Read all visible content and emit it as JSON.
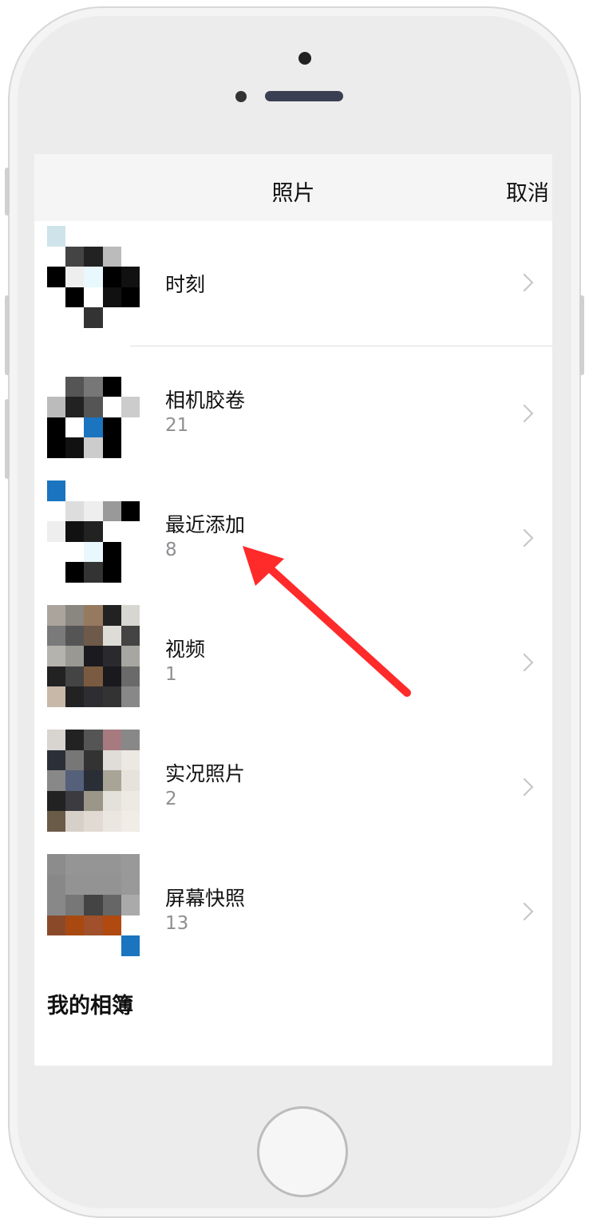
{
  "navbar": {
    "title": "照片",
    "cancel": "取消"
  },
  "albums": [
    {
      "title": "时刻",
      "count": ""
    },
    {
      "title": "相机胶卷",
      "count": "21"
    },
    {
      "title": "最近添加",
      "count": "8"
    },
    {
      "title": "视频",
      "count": "1"
    },
    {
      "title": "实况照片",
      "count": "2"
    },
    {
      "title": "屏幕快照",
      "count": "13"
    }
  ],
  "section": {
    "my_albums": "我的相簿"
  },
  "icons": {
    "chevron": "chevron-right-icon",
    "annotation": "red-arrow-icon"
  },
  "colors": {
    "annotation": "#ff2a2a",
    "count_text": "#8e8e93",
    "navbar_bg": "#f5f5f5"
  }
}
